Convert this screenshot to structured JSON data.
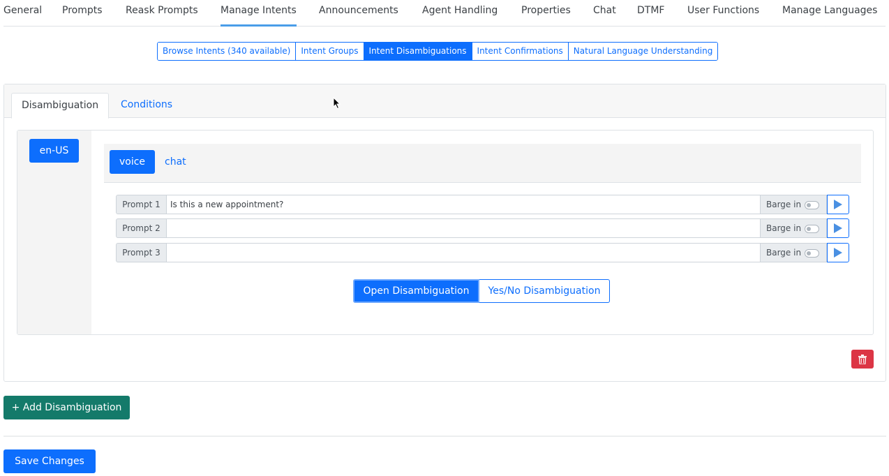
{
  "top_nav": {
    "tabs": [
      {
        "label": "General"
      },
      {
        "label": "Prompts"
      },
      {
        "label": "Reask Prompts"
      },
      {
        "label": "Manage Intents",
        "active": true
      },
      {
        "label": "Announcements"
      },
      {
        "label": "Agent Handling"
      },
      {
        "label": "Properties"
      },
      {
        "label": "Chat"
      },
      {
        "label": "DTMF"
      },
      {
        "label": "User Functions"
      },
      {
        "label": "Manage Languages"
      }
    ]
  },
  "sub_nav": {
    "segments": [
      {
        "label": "Browse Intents (340 available)"
      },
      {
        "label": "Intent Groups"
      },
      {
        "label": "Intent Disambiguations",
        "active": true
      },
      {
        "label": "Intent Confirmations"
      },
      {
        "label": "Natural Language Understanding"
      }
    ]
  },
  "card": {
    "tabs": [
      {
        "label": "Disambiguation",
        "active": true
      },
      {
        "label": "Conditions"
      }
    ],
    "language": "en-US",
    "channels": {
      "voice": "voice",
      "chat": "chat",
      "selected": "voice"
    },
    "prompts": [
      {
        "label": "Prompt 1",
        "value": "Is this a new appointment?",
        "barge_label": "Barge in",
        "barge_in": false
      },
      {
        "label": "Prompt 2",
        "value": "",
        "barge_label": "Barge in",
        "barge_in": false
      },
      {
        "label": "Prompt 3",
        "value": "",
        "barge_label": "Barge in",
        "barge_in": false
      }
    ],
    "disambiguation_type": {
      "open_label": "Open Disambiguation",
      "yes_no_label": "Yes/No Disambiguation",
      "selected": "open"
    },
    "delete_icon": "trash-icon"
  },
  "actions": {
    "add_label": "+ Add Disambiguation",
    "save_label": "Save Changes"
  },
  "colors": {
    "primary": "#0d6efd",
    "success": "#147a6a",
    "danger": "#dc3545"
  }
}
